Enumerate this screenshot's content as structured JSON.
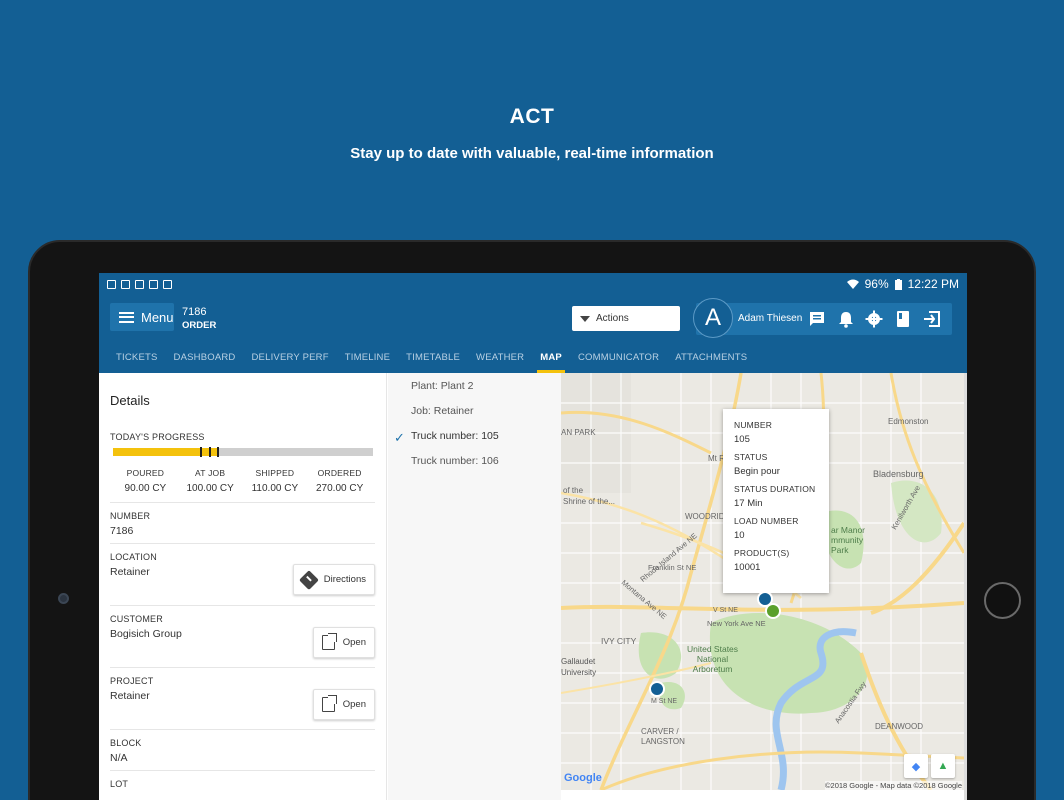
{
  "hero": {
    "title": "ACT",
    "subtitle": "Stay up to date with valuable, real-time information"
  },
  "statusbar": {
    "battery": "96%",
    "time": "12:22 PM"
  },
  "appbar": {
    "menu_label": "Menu",
    "order_number": "7186",
    "order_label": "ORDER",
    "actions_label": "Actions",
    "avatar_letter": "A",
    "user_name": "Adam Thiesen"
  },
  "tabs": [
    {
      "label": "TICKETS"
    },
    {
      "label": "DASHBOARD"
    },
    {
      "label": "DELIVERY PERF"
    },
    {
      "label": "TIMELINE"
    },
    {
      "label": "TIMETABLE"
    },
    {
      "label": "WEATHER"
    },
    {
      "label": "MAP"
    },
    {
      "label": "COMMUNICATOR"
    },
    {
      "label": "ATTACHMENTS"
    }
  ],
  "details": {
    "title": "Details",
    "progress_label": "TODAY'S PROGRESS",
    "progress": {
      "poured": 90,
      "at_job": 100,
      "shipped": 110,
      "ordered": 270
    },
    "columns": [
      {
        "label": "POURED",
        "value": "90.00 CY"
      },
      {
        "label": "AT JOB",
        "value": "100.00 CY"
      },
      {
        "label": "SHIPPED",
        "value": "110.00 CY"
      },
      {
        "label": "ORDERED",
        "value": "270.00 CY"
      }
    ],
    "number_label": "NUMBER",
    "number_value": "7186",
    "location_label": "LOCATION",
    "location_value": "Retainer",
    "directions_label": "Directions",
    "customer_label": "CUSTOMER",
    "customer_value": "Bogisich Group",
    "open_label": "Open",
    "project_label": "PROJECT",
    "project_value": "Retainer",
    "block_label": "BLOCK",
    "block_value": "N/A",
    "lot_label": "LOT"
  },
  "map_list": [
    {
      "label": "Plant: Plant 2"
    },
    {
      "label": "Job: Retainer"
    },
    {
      "label": "Truck number: 105",
      "checked": true
    },
    {
      "label": "Truck number: 106"
    }
  ],
  "info_card": {
    "number_label": "NUMBER",
    "number": "105",
    "status_label": "STATUS",
    "status": "Begin pour",
    "duration_label": "STATUS DURATION",
    "duration": "17 Min",
    "load_label": "LOAD NUMBER",
    "load": "10",
    "product_label": "PRODUCT(S)",
    "product": "10001"
  },
  "map_labels": {
    "edmonston": "Edmonston",
    "bladensburg": "Bladensburg",
    "mt_ranier": "Mt R",
    "woodridge": "WOODRID",
    "manor_park": "ar Manor\nmmunity\nPark",
    "an_park": "AN PARK",
    "shrine": "of the\nShrine of the...",
    "rhode_island": "Rhode Island Ave NE",
    "franklin": "Franklin St NE",
    "montana": "Montana Ave NE",
    "v_st": "V St NE",
    "new_york": "New York Ave NE",
    "ivy_city": "IVY CITY",
    "arboretum": "United States\nNational\nArboretum",
    "gallaudet": "Gallaudet\nUniversity",
    "m_st": "M St NE",
    "carver": "CARVER /\nLANGSTON",
    "deanwood": "DEANWOOD",
    "kenilworth": "Kenilworth Ave",
    "anacostia": "Anacostia Fwy",
    "google": "Google",
    "copyright": "©2018 Google - Map data ©2018 Google"
  },
  "colors": {
    "brand": "#135f94",
    "accent": "#f4c20d"
  }
}
